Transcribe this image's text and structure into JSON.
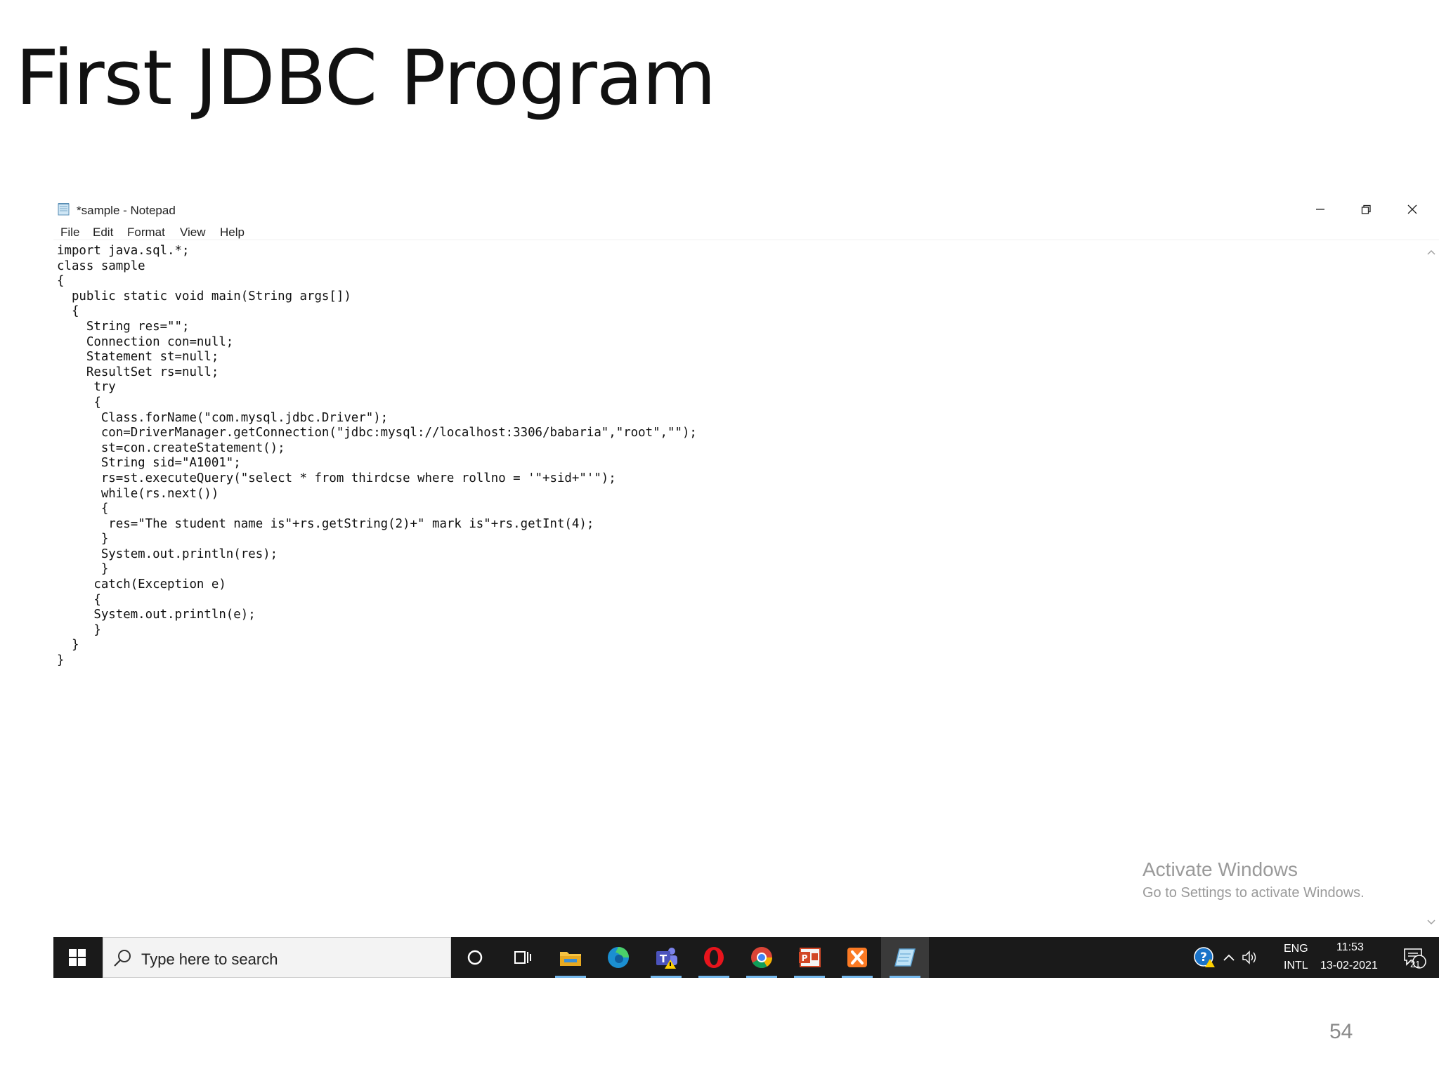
{
  "slide": {
    "title": "First JDBC Program",
    "page_number": "54"
  },
  "window": {
    "title": "*sample - Notepad",
    "menu": [
      "File",
      "Edit",
      "Format",
      "View",
      "Help"
    ]
  },
  "editor": {
    "content": "import java.sql.*;\nclass sample\n{\n  public static void main(String args[])\n  {\n    String res=\"\";\n    Connection con=null;\n    Statement st=null;\n    ResultSet rs=null;\n     try\n     {\n      Class.forName(\"com.mysql.jdbc.Driver\");\n      con=DriverManager.getConnection(\"jdbc:mysql://localhost:3306/babaria\",\"root\",\"\");\n      st=con.createStatement();\n      String sid=\"A1001\";\n      rs=st.executeQuery(\"select * from thirdcse where rollno = '\"+sid+\"'\");\n      while(rs.next())\n      {\n       res=\"The student name is\"+rs.getString(2)+\" mark is\"+rs.getInt(4);\n      }\n      System.out.println(res);\n      }\n     catch(Exception e)\n     {\n     System.out.println(e);\n     }\n  }\n}"
  },
  "watermark": {
    "line1": "Activate Windows",
    "line2": "Go to Settings to activate Windows."
  },
  "taskbar": {
    "search_placeholder": "Type here to search",
    "apps": [
      "cortana-icon",
      "task-view-icon",
      "file-explorer-icon",
      "edge-icon",
      "teams-icon",
      "opera-icon",
      "chrome-icon",
      "powerpoint-icon",
      "xampp-icon",
      "notepad-icon"
    ],
    "language_top": "ENG",
    "language_bottom": "INTL",
    "time": "11:53",
    "date": "13-02-2021",
    "notification_count": "21"
  },
  "colors": {
    "taskbar_bg": "#1a1a1a",
    "accent": "#76b9ed",
    "watermark": "#9a9a9a"
  }
}
